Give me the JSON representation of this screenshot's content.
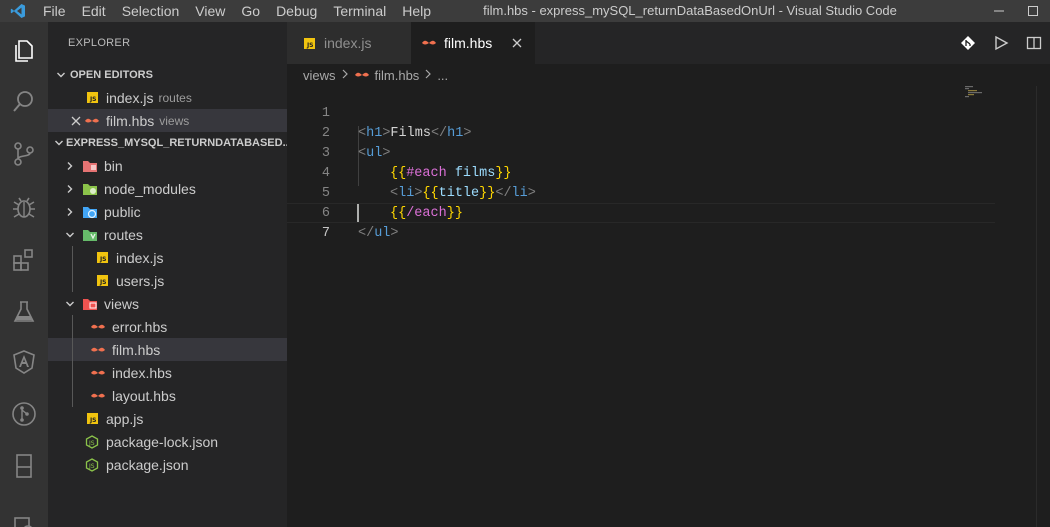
{
  "titlebar": {
    "menu": [
      "File",
      "Edit",
      "Selection",
      "View",
      "Go",
      "Debug",
      "Terminal",
      "Help"
    ],
    "window_title": "film.hbs - express_mySQL_returnDataBasedOnUrl - Visual Studio Code"
  },
  "sidebar": {
    "title": "EXPLORER",
    "open_editors": {
      "header": "OPEN EDITORS",
      "items": [
        {
          "name": "index.js",
          "desc": "routes"
        },
        {
          "name": "film.hbs",
          "desc": "views"
        }
      ]
    },
    "project": {
      "header": "EXPRESS_MYSQL_RETURNDATABASED...",
      "tree": [
        {
          "label": "bin"
        },
        {
          "label": "node_modules"
        },
        {
          "label": "public"
        },
        {
          "label": "routes"
        },
        {
          "label": "index.js"
        },
        {
          "label": "users.js"
        },
        {
          "label": "views"
        },
        {
          "label": "error.hbs"
        },
        {
          "label": "film.hbs"
        },
        {
          "label": "index.hbs"
        },
        {
          "label": "layout.hbs"
        },
        {
          "label": "app.js"
        },
        {
          "label": "package-lock.json"
        },
        {
          "label": "package.json"
        }
      ]
    }
  },
  "tabs": [
    {
      "label": "index.js",
      "active": false
    },
    {
      "label": "film.hbs",
      "active": true
    }
  ],
  "breadcrumbs": [
    "views",
    "film.hbs",
    "..."
  ],
  "editor": {
    "line_numbers": [
      "1",
      "2",
      "3",
      "4",
      "5",
      "6",
      "7"
    ],
    "active_line": "7",
    "tokens": {
      "l1": [
        "<",
        "h1",
        ">",
        "Films",
        "</",
        "h1",
        ">"
      ],
      "l2": [
        "<",
        "ul",
        ">"
      ],
      "l3": [
        "{{",
        "#each",
        " films",
        "}}"
      ],
      "l4": [
        "<",
        "li",
        ">",
        "{{",
        "title",
        "}}",
        "</",
        "li",
        ">"
      ],
      "l5": [
        "{{",
        "/each",
        "}}"
      ],
      "l6": [
        "</",
        "ul",
        ">"
      ]
    }
  },
  "colors": {
    "accent": "#007acc",
    "js_icon": "#f1c40f",
    "hbs_icon": "#f0704f",
    "tag": "#569cd6",
    "handlebars_brace": "#ffd700",
    "handlebars_keyword": "#da70d6"
  },
  "icons": {
    "logo": "vscode-logo-icon",
    "activity": [
      "explorer-icon",
      "search-icon",
      "source-control-icon",
      "debug-icon",
      "extensions-icon",
      "test-flask-icon",
      "angular-icon",
      "git-graph-icon",
      "remote-explorer-icon",
      "azure-icon"
    ]
  }
}
